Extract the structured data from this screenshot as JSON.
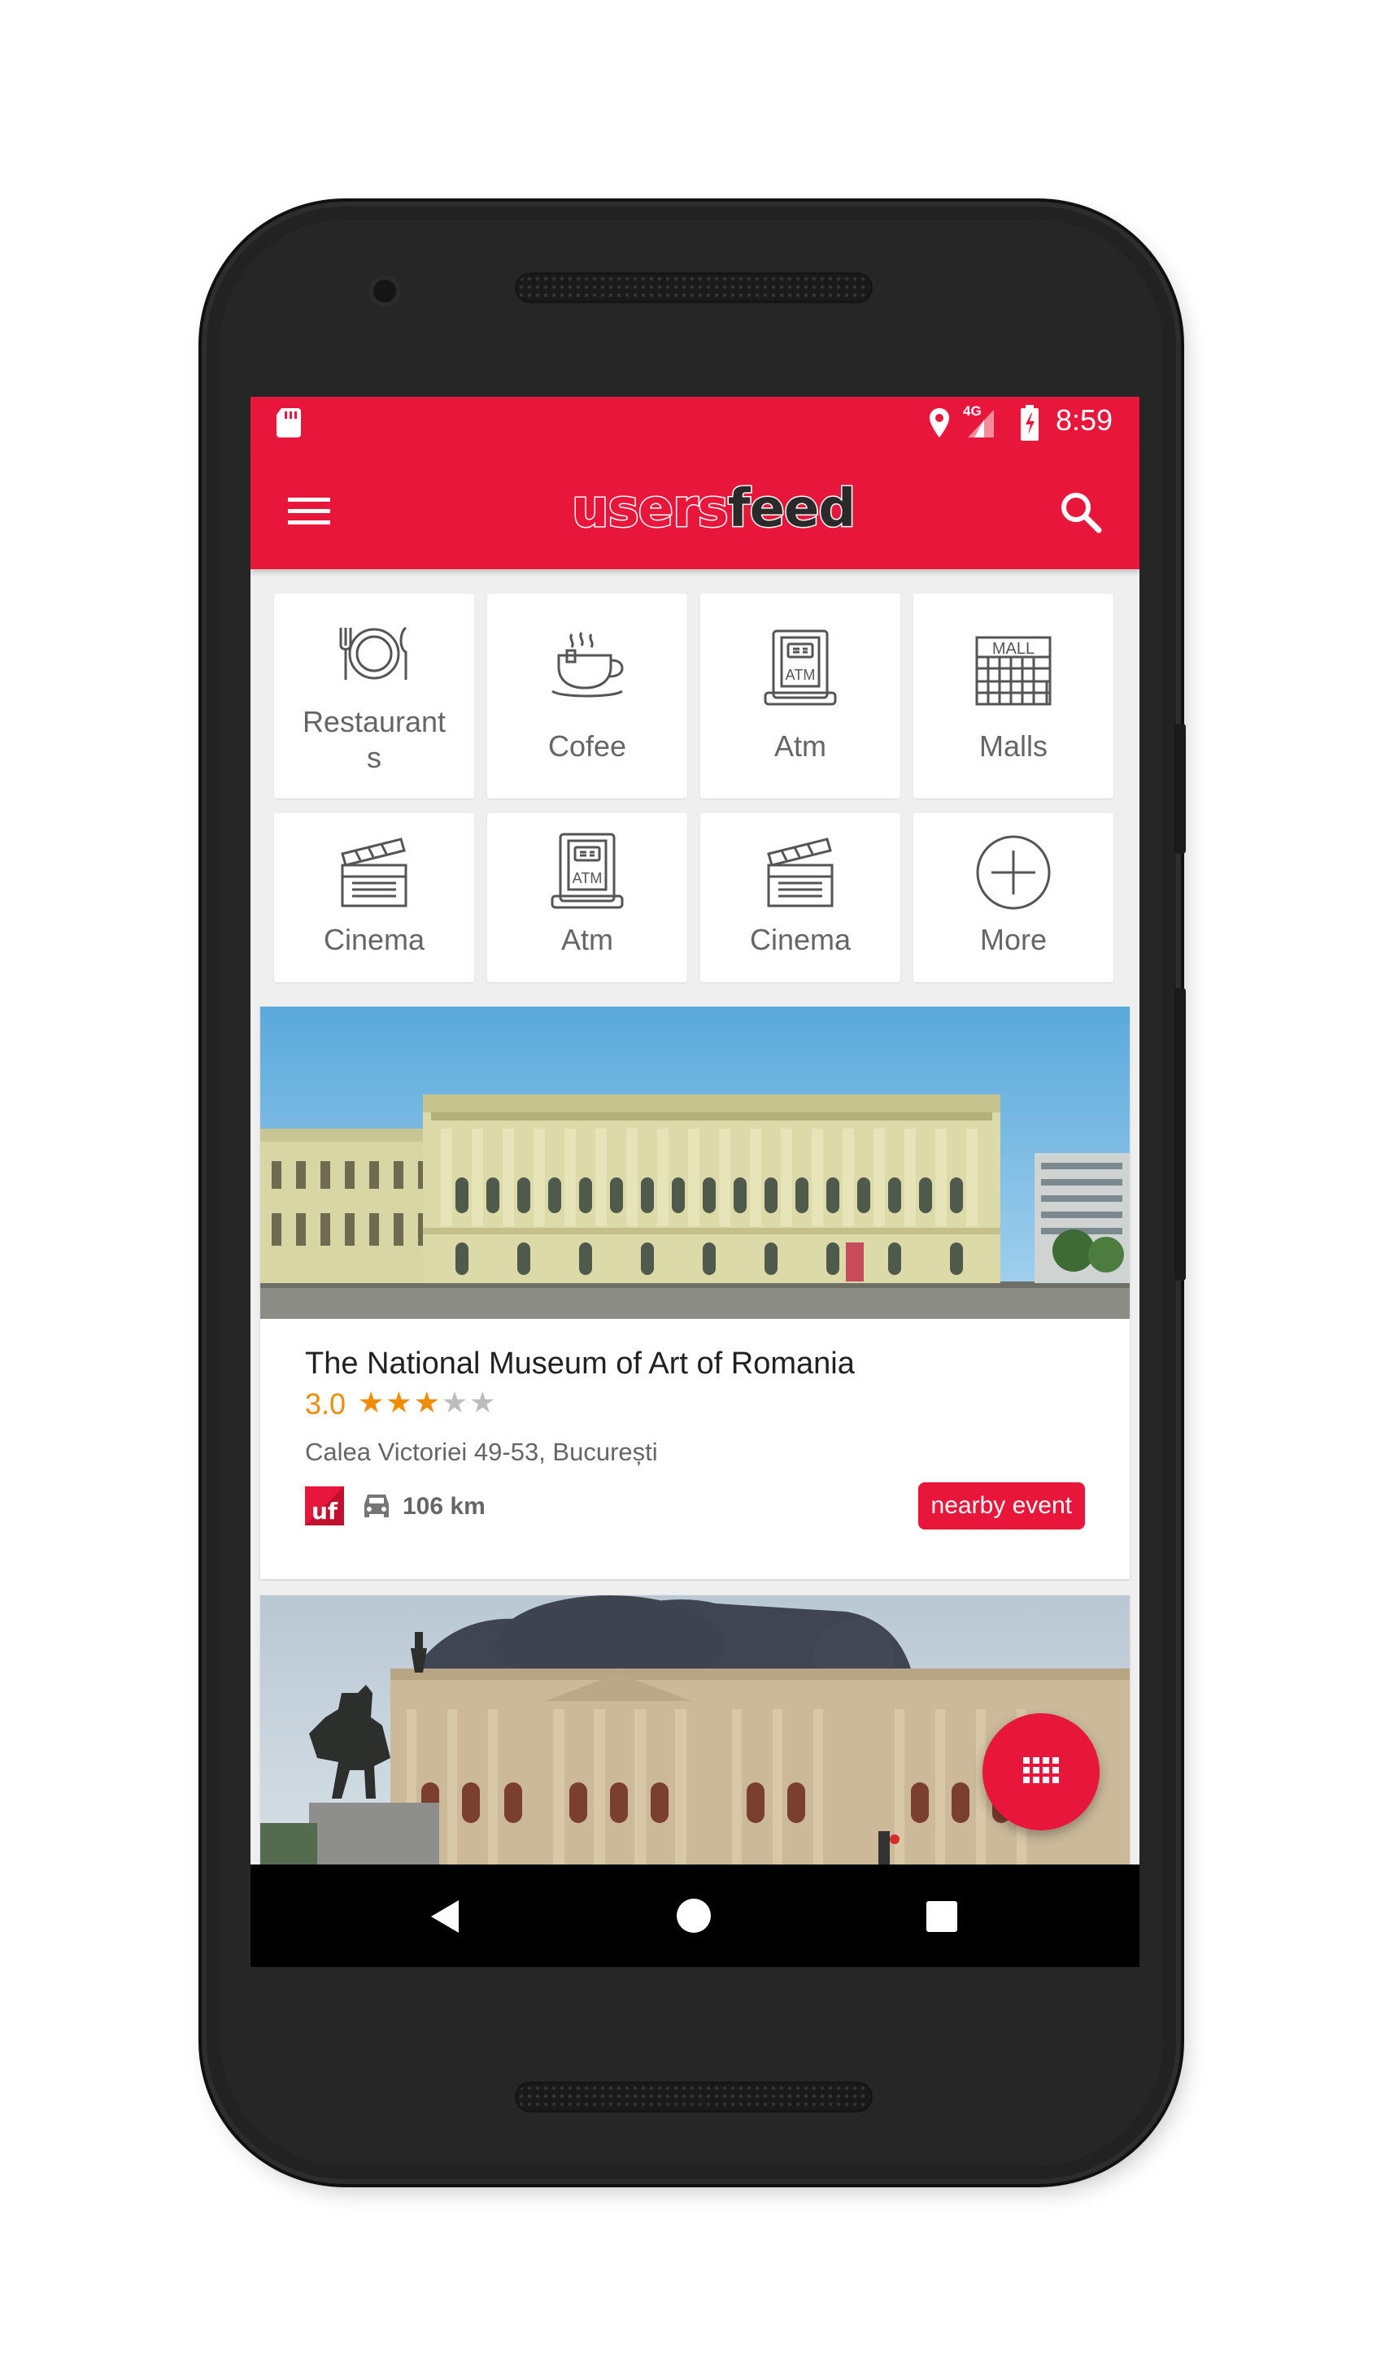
{
  "status_bar": {
    "time": "8:59",
    "network": "4G",
    "icons": [
      "sd-card-icon",
      "location-icon",
      "signal-icon",
      "battery-charging-icon"
    ]
  },
  "app_bar": {
    "logo_part1": "users",
    "logo_part2": "feed",
    "menu_icon": "hamburger-menu-icon",
    "search_icon": "search-icon",
    "color": "#e8163a"
  },
  "categories": [
    {
      "label": "Restaurant\ns",
      "icon": "restaurant-icon"
    },
    {
      "label": "Cofee",
      "icon": "coffee-cup-icon"
    },
    {
      "label": "Atm",
      "icon": "atm-icon"
    },
    {
      "label": "Malls",
      "icon": "mall-icon"
    },
    {
      "label": "Cinema",
      "icon": "clapperboard-icon"
    },
    {
      "label": "Atm",
      "icon": "atm-icon"
    },
    {
      "label": "Cinema",
      "icon": "clapperboard-icon"
    },
    {
      "label": "More",
      "icon": "plus-circle-icon"
    }
  ],
  "places": [
    {
      "title": "The National Museum of Art of Romania",
      "rating": "3.0",
      "stars_filled": 3,
      "stars_total": 5,
      "address": "Calea Victoriei 49-53, București",
      "distance": "106 km",
      "badge": "nearby event",
      "source_icon": "usersfeed-mini-logo-icon",
      "transport_icon": "car-icon"
    },
    {
      "title": "",
      "image": "palace-with-equestrian-statue"
    }
  ],
  "fab": {
    "icon": "grid-icon"
  },
  "nav": {
    "back": "back-icon",
    "home": "home-icon",
    "recents": "recents-icon"
  },
  "colors": {
    "accent": "#e8163a",
    "star": "#f08c00",
    "star_empty": "#bdbdbd"
  }
}
